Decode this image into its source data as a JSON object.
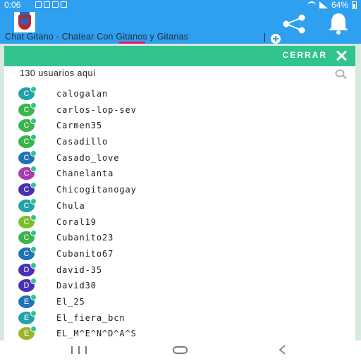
{
  "status_bar": {
    "time": "0:06",
    "battery": "64%"
  },
  "colors": {
    "app_bar": "#2f9ff0",
    "accent_green": "#31c48c",
    "tab_indicator": "#e8196b"
  },
  "app_bar": {
    "logo_icon": "shield-crest-icon",
    "share_icon": "share-icon",
    "notification_icon": "bell-icon"
  },
  "tab": {
    "title": "Chat Gitano - Chatear Con Gitanos y Gitanas",
    "add_icon": "plus-circle-icon"
  },
  "panel": {
    "close_label": "CERRAR",
    "close_icon": "close-icon",
    "user_count": "130 usuarios aquí",
    "search_icon": "search-icon"
  },
  "users": [
    {
      "initial": "C",
      "name": "calogalan",
      "color": "#22a3a9"
    },
    {
      "initial": "C",
      "name": "carlos-lop-sev",
      "color": "#3ab54a"
    },
    {
      "initial": "C",
      "name": "Carmen35",
      "color": "#3ab54a"
    },
    {
      "initial": "C",
      "name": "Casadillo",
      "color": "#3ab54a"
    },
    {
      "initial": "C",
      "name": "Casado_love",
      "color": "#1f73b7"
    },
    {
      "initial": "C",
      "name": "Chanelanta",
      "color": "#a63cae"
    },
    {
      "initial": "C",
      "name": "Chicogitanogay",
      "color": "#4a2fb5"
    },
    {
      "initial": "C",
      "name": "Chula",
      "color": "#22a3a9"
    },
    {
      "initial": "C",
      "name": "Coral19",
      "color": "#7cbf2c"
    },
    {
      "initial": "C",
      "name": "Cubanito23",
      "color": "#3ab54a"
    },
    {
      "initial": "C",
      "name": "Cubanito67",
      "color": "#1f73b7"
    },
    {
      "initial": "D",
      "name": "david-35",
      "color": "#4a2fb5"
    },
    {
      "initial": "D",
      "name": "David30",
      "color": "#4a2fb5"
    },
    {
      "initial": "E",
      "name": "El_25",
      "color": "#1f73b7"
    },
    {
      "initial": "E",
      "name": "El_fiera_bcn",
      "color": "#22a3a9"
    },
    {
      "initial": "E",
      "name": "EL_M^E^N^D^A^S",
      "color": "#9ab52a"
    }
  ],
  "nav_bar": {
    "recent_icon": "recent-apps-icon",
    "home_icon": "home-icon",
    "back_icon": "back-icon"
  }
}
